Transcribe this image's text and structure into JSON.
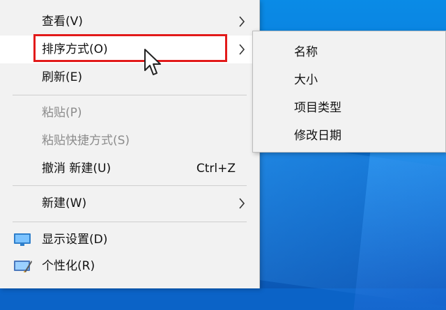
{
  "context_menu": {
    "items": [
      {
        "label": "查看(V)",
        "has_submenu": true
      },
      {
        "label": "排序方式(O)",
        "has_submenu": true,
        "highlighted": true
      },
      {
        "label": "刷新(E)"
      },
      {
        "label": "粘贴(P)",
        "disabled": true
      },
      {
        "label": "粘贴快捷方式(S)",
        "disabled": true
      },
      {
        "label": "撤消 新建(U)",
        "shortcut": "Ctrl+Z"
      },
      {
        "label": "新建(W)",
        "has_submenu": true
      },
      {
        "label": "显示设置(D)",
        "icon": "display-settings-icon"
      },
      {
        "label": "个性化(R)",
        "icon": "personalize-icon"
      }
    ]
  },
  "sort_submenu": {
    "items": [
      {
        "label": "名称"
      },
      {
        "label": "大小"
      },
      {
        "label": "项目类型"
      },
      {
        "label": "修改日期"
      }
    ]
  },
  "colors": {
    "menu_bg": "#f2f2f2",
    "highlight_border": "#e21a1a",
    "disabled_text": "#8c8c8c",
    "desktop_blue": "#0b74d6"
  }
}
